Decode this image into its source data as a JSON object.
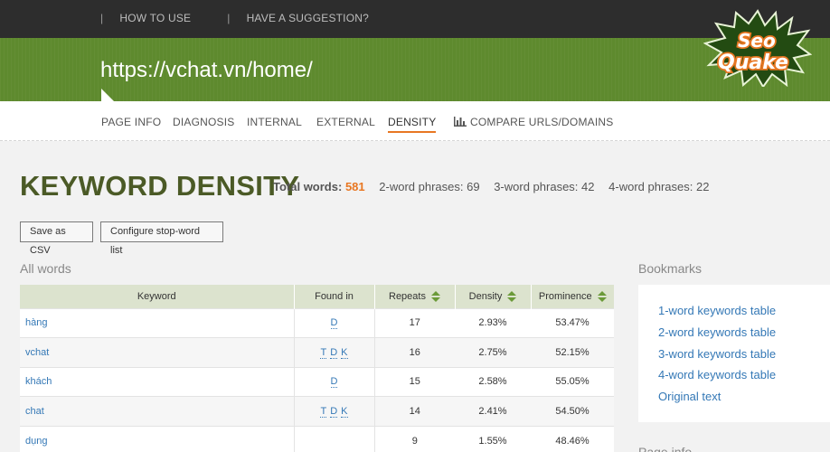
{
  "topnav": {
    "sep": "|",
    "how_to_use": "HOW TO USE",
    "suggestion": "HAVE A SUGGESTION?"
  },
  "header": {
    "url": "https://vchat.vn/home/"
  },
  "logo": {
    "text_top": "Seo",
    "text_bottom": "Quake"
  },
  "tabs": [
    {
      "label": "PAGE INFO"
    },
    {
      "label": "DIAGNOSIS"
    },
    {
      "label": "INTERNAL"
    },
    {
      "label": "EXTERNAL"
    },
    {
      "label": "DENSITY"
    },
    {
      "label": "COMPARE URLS/DOMAINS",
      "icon": "bar-chart-icon"
    }
  ],
  "active_tab": "DENSITY",
  "page": {
    "title": "KEYWORD DENSITY",
    "total_words_label": "Total words:",
    "total_words": "581",
    "two_word_label": "2-word phrases:",
    "two_word": "69",
    "three_word_label": "3-word phrases:",
    "three_word": "42",
    "four_word_label": "4-word phrases:",
    "four_word": "22"
  },
  "buttons": {
    "save_csv": "Save as CSV",
    "configure": "Configure stop-word list"
  },
  "all_words": {
    "label": "All words",
    "columns": [
      "Keyword",
      "Found in",
      "Repeats",
      "Density",
      "Prominence"
    ],
    "rows": [
      {
        "keyword": "hàng",
        "found": [
          "D"
        ],
        "repeats": "17",
        "density": "2.93%",
        "prominence": "53.47%"
      },
      {
        "keyword": "vchat",
        "found": [
          "T",
          "D",
          "K"
        ],
        "repeats": "16",
        "density": "2.75%",
        "prominence": "52.15%"
      },
      {
        "keyword": "khách",
        "found": [
          "D"
        ],
        "repeats": "15",
        "density": "2.58%",
        "prominence": "55.05%"
      },
      {
        "keyword": "chat",
        "found": [
          "T",
          "D",
          "K"
        ],
        "repeats": "14",
        "density": "2.41%",
        "prominence": "54.50%"
      },
      {
        "keyword": "dụng",
        "found": [],
        "repeats": "9",
        "density": "1.55%",
        "prominence": "48.46%"
      }
    ]
  },
  "bookmarks": {
    "label": "Bookmarks",
    "links": [
      "1-word keywords table",
      "2-word keywords table",
      "3-word keywords table",
      "4-word keywords table",
      "Original text"
    ]
  },
  "partial_section": "Page info",
  "colors": {
    "accent": "#e87722",
    "header_green": "#5e8a2e",
    "title_green": "#4b5a26",
    "link_blue": "#3478b6",
    "table_head": "#dce3ce"
  }
}
